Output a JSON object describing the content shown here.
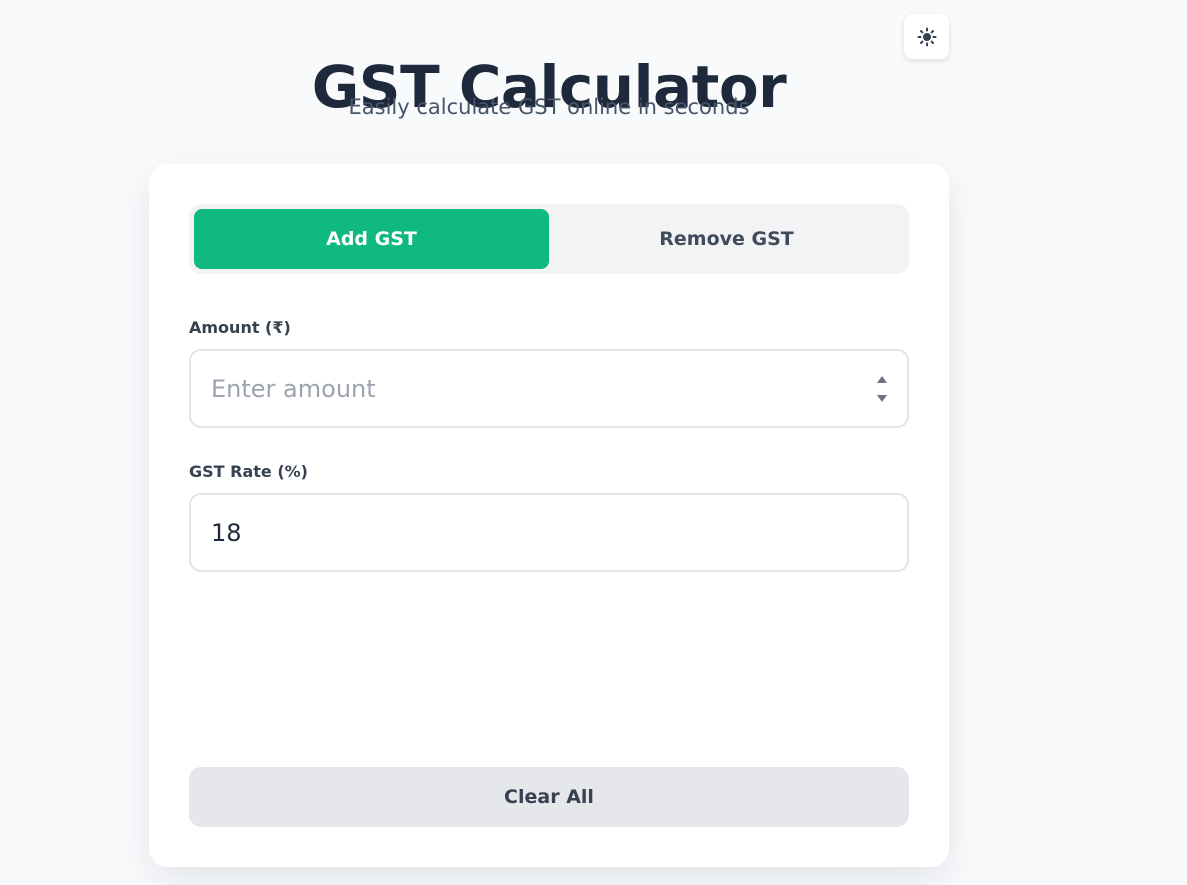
{
  "header": {
    "title": "GST Calculator",
    "subtitle": "Easily calculate GST online in seconds"
  },
  "theme_toggle": {
    "icon": "sun-icon"
  },
  "mode_switch": {
    "add_label": "Add GST",
    "remove_label": "Remove GST",
    "selected": "Add GST"
  },
  "amount": {
    "label": "Amount (₹)",
    "placeholder": "Enter amount",
    "value": ""
  },
  "rate": {
    "label": "GST Rate (%)",
    "value": "18"
  },
  "actions": {
    "clear_label": "Clear All"
  },
  "colors": {
    "accent": "#10b981",
    "background": "#f8fafc",
    "heading": "#1e293b"
  }
}
